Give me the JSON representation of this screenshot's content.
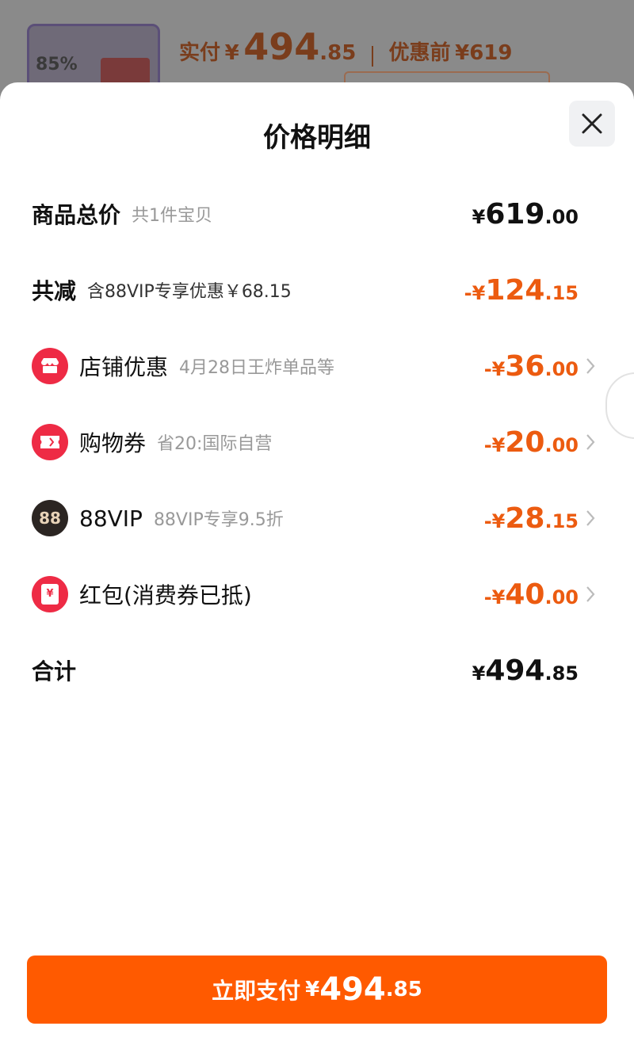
{
  "background": {
    "thumb_tag": "85%",
    "pay_label": "实付",
    "currency": "¥",
    "pay_amount_int": "494",
    "pay_amount_dec": ".85",
    "pre_label": "优惠前",
    "pre_amount": "¥619"
  },
  "sheet": {
    "title": "价格明细",
    "rows": [
      {
        "title": "商品总价",
        "sub": "共1件宝贝",
        "amount_prefix": "¥",
        "amount_int": "619",
        "amount_dec": ".00"
      },
      {
        "title": "共减",
        "sub": "含88VIP专享优惠￥68.15",
        "amount_prefix": "-¥",
        "amount_int": "124",
        "amount_dec": ".15"
      },
      {
        "title": "店铺优惠",
        "sub": "4月28日王炸单品等",
        "amount_prefix": "-¥",
        "amount_int": "36",
        "amount_dec": ".00",
        "icon": "shop-icon"
      },
      {
        "title": "购物券",
        "sub": "省20:国际自营",
        "amount_prefix": "-¥",
        "amount_int": "20",
        "amount_dec": ".00",
        "icon": "ticket-icon"
      },
      {
        "title": "88VIP",
        "sub": "88VIP专享9.5折",
        "amount_prefix": "-¥",
        "amount_int": "28",
        "amount_dec": ".15",
        "icon": "vip88-icon"
      },
      {
        "title": "红包(消费券已抵)",
        "sub": "",
        "amount_prefix": "-¥",
        "amount_int": "40",
        "amount_dec": ".00",
        "icon": "red-packet-icon"
      },
      {
        "title": "合计",
        "sub": "",
        "amount_prefix": "¥",
        "amount_int": "494",
        "amount_dec": ".85"
      }
    ]
  },
  "pay_button": {
    "label": "立即支付",
    "currency": "¥",
    "amount_int": "494",
    "amount_dec": ".85"
  },
  "vip_icon_text": "88",
  "red_packet_symbol": "¥",
  "colors": {
    "accent": "#ff5a00",
    "discount": "#ec5b10",
    "icon_red": "#ee2b45"
  }
}
